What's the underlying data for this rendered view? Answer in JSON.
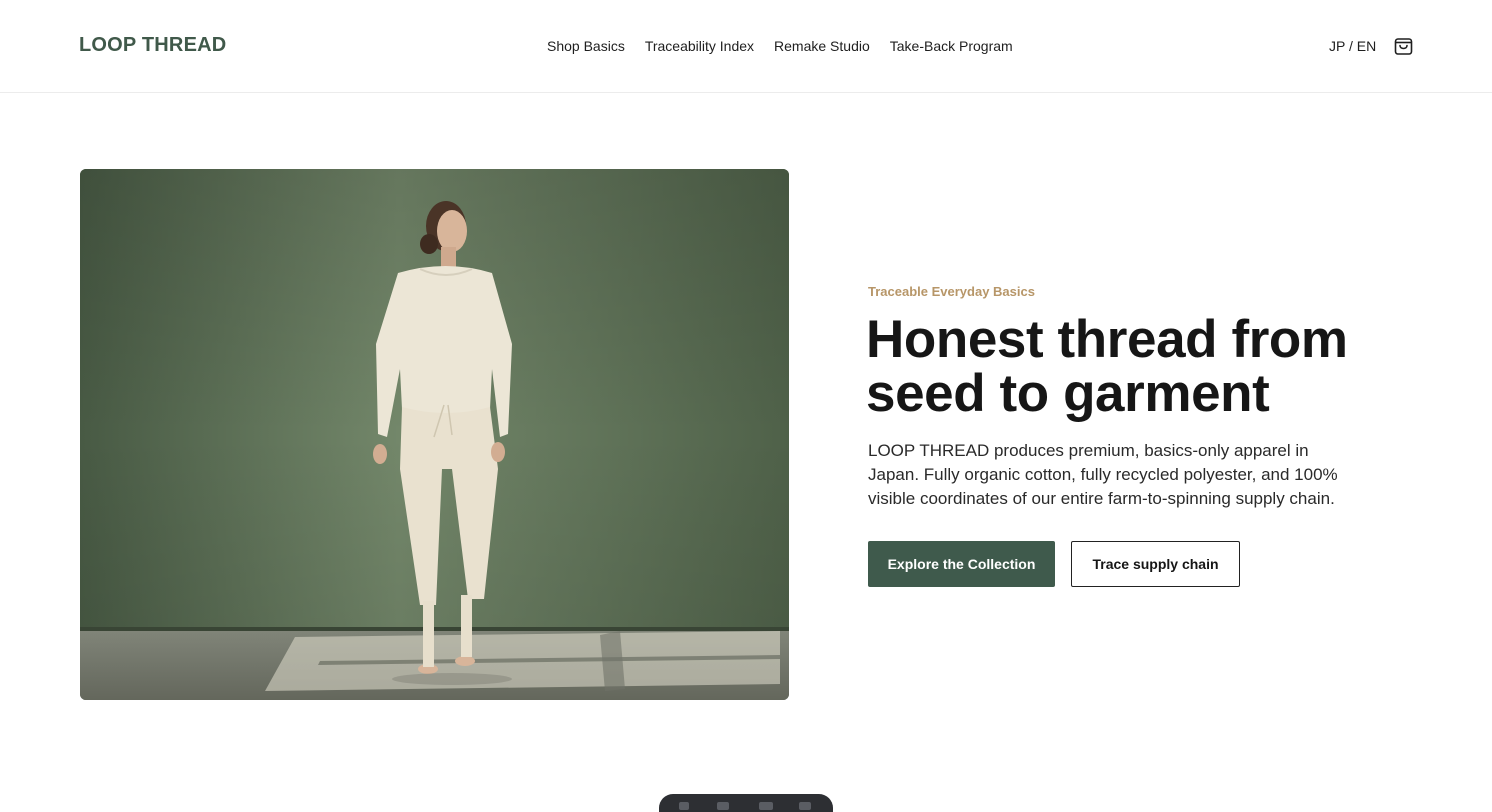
{
  "header": {
    "logo": "LOOP THREAD",
    "nav": [
      "Shop Basics",
      "Traceability Index",
      "Remake Studio",
      "Take-Back Program"
    ],
    "language_toggle": "JP / EN",
    "cart_icon": "shopping-bag-icon"
  },
  "hero": {
    "image_icon": "model-in-cream-loungewear-photo",
    "eyebrow": "Traceable Everyday Basics",
    "headline": "Honest thread from seed to garment",
    "body": "LOOP THREAD produces premium, basics-only apparel in Japan. Fully organic cotton, fully recycled polyester, and 100% visible coordinates of our entire farm-to-spinning supply chain.",
    "primary_cta": "Explore the Collection",
    "secondary_cta": "Trace supply chain"
  },
  "colors": {
    "brand": "#40594a",
    "accent": "#b79668",
    "primary_button": "#3f5a4c",
    "photo_background": "#6b7e64"
  }
}
